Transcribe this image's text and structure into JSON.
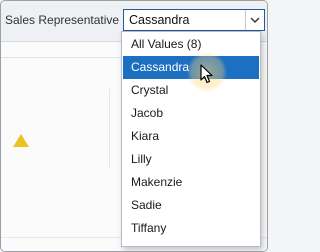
{
  "filter": {
    "label": "Sales Representative",
    "selected_value": "Cassandra"
  },
  "dropdown": {
    "items": [
      {
        "label": "All Values (8)"
      },
      {
        "label": "Cassandra"
      },
      {
        "label": "Crystal"
      },
      {
        "label": "Jacob"
      },
      {
        "label": "Kiara"
      },
      {
        "label": "Lilly"
      },
      {
        "label": "Makenzie"
      },
      {
        "label": "Sadie"
      },
      {
        "label": "Tiffany"
      }
    ],
    "highlighted_item": "Cassandra"
  },
  "icons": {
    "combo_arrow": "chevron-down-icon",
    "warning": "warning-triangle-icon",
    "cursor": "hand-pointer-cursor"
  },
  "colors": {
    "selection": "#1d6fc2",
    "combo_border": "#1e5a9e",
    "warning": "#e8c323"
  }
}
